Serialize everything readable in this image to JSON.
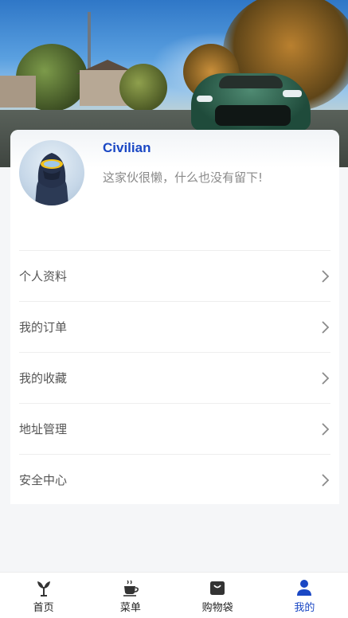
{
  "profile": {
    "name": "Civilian",
    "bio": "这家伙很懒，什么也没有留下!"
  },
  "menu": {
    "items": [
      {
        "label": "个人资料",
        "icon": "chevron-right-icon"
      },
      {
        "label": "我的订单",
        "icon": "chevron-right-icon"
      },
      {
        "label": "我的收藏",
        "icon": "chevron-right-icon"
      },
      {
        "label": "地址管理",
        "icon": "chevron-right-icon"
      },
      {
        "label": "安全中心",
        "icon": "chevron-right-icon"
      }
    ]
  },
  "tabbar": {
    "items": [
      {
        "label": "首页",
        "icon": "home-plant-icon",
        "active": false
      },
      {
        "label": "菜单",
        "icon": "coffee-cup-icon",
        "active": false
      },
      {
        "label": "购物袋",
        "icon": "shopping-bag-icon",
        "active": false
      },
      {
        "label": "我的",
        "icon": "user-icon",
        "active": true
      }
    ]
  },
  "colors": {
    "accent": "#1a47c4",
    "page_background": "#f5f6f8",
    "card_background": "#ffffff",
    "muted_text": "#8a8a8a",
    "menu_text": "#555555"
  }
}
